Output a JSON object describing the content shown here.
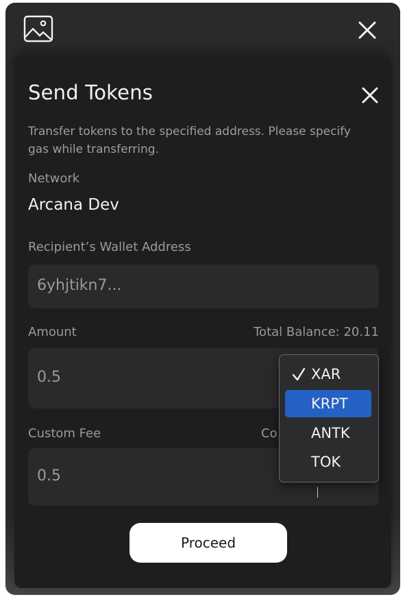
{
  "window": {
    "image_icon": "image-icon",
    "close_icon": "close-icon"
  },
  "modal": {
    "title": "Send Tokens",
    "close_icon": "close-icon",
    "description": "Transfer tokens to the specified address. Please specify gas while transferring.",
    "network": {
      "label": "Network",
      "value": "Arcana Dev"
    },
    "recipient": {
      "label": "Recipient’s Wallet Address",
      "value": "6yhjtikn7..."
    },
    "amount": {
      "label": "Amount",
      "balance": "Total Balance: 20.11",
      "value": "0.5"
    },
    "custom_fee": {
      "label": "Custom Fee",
      "partial_label": "Co",
      "value": "0.5"
    },
    "proceed_label": "Proceed"
  },
  "token_dropdown": {
    "options": [
      "XAR",
      "KRPT",
      "ANTK",
      "TOK"
    ],
    "checked": "XAR",
    "highlighted": "KRPT"
  },
  "colors": {
    "background": "#2a2a2b",
    "modal": "#1e1e1f",
    "field": "#2a2a2c",
    "highlight": "#2461c5",
    "button": "#ffffff"
  }
}
